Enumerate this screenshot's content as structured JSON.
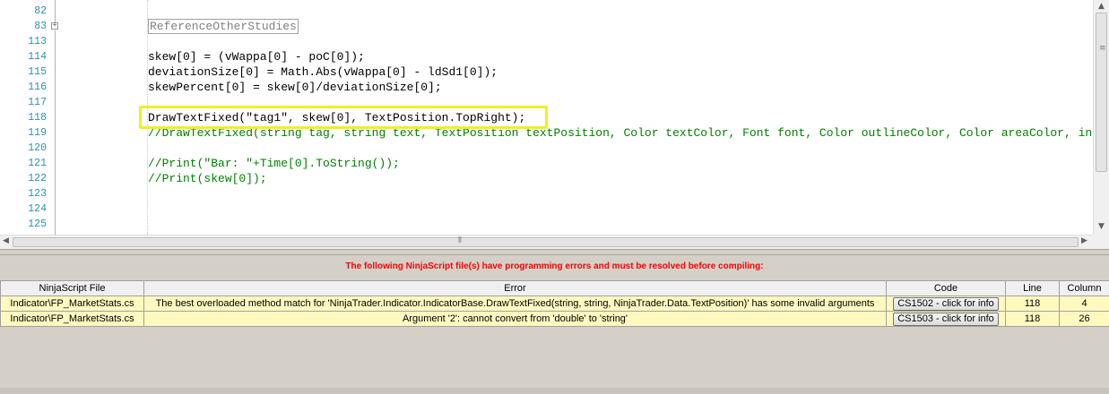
{
  "editor": {
    "lines": [
      {
        "num": "82",
        "code": "",
        "type": "blank"
      },
      {
        "num": "83",
        "code": "ReferenceOtherStudies",
        "type": "region",
        "fold": "+"
      },
      {
        "num": "113",
        "code": "",
        "type": "blank"
      },
      {
        "num": "114",
        "code": "skew[0] = (vWappa[0] - poC[0]);",
        "type": "code"
      },
      {
        "num": "115",
        "code": "deviationSize[0] = Math.Abs(vWappa[0] - ldSd1[0]);",
        "type": "code"
      },
      {
        "num": "116",
        "code": "skewPercent[0] = skew[0]/deviationSize[0];",
        "type": "code"
      },
      {
        "num": "117",
        "code": "",
        "type": "blank"
      },
      {
        "num": "118",
        "code": "DrawTextFixed(\"tag1\", skew[0], TextPosition.TopRight);",
        "type": "code"
      },
      {
        "num": "119",
        "code": "//DrawTextFixed(string tag, string text, TextPosition textPosition, Color textColor, Font font, Color outlineColor, Color areaColor, int opacity);",
        "type": "comment"
      },
      {
        "num": "120",
        "code": "",
        "type": "blank"
      },
      {
        "num": "121",
        "code": "//Print(\"Bar: \"+Time[0].ToString());",
        "type": "comment"
      },
      {
        "num": "122",
        "code": "//Print(skew[0]);",
        "type": "comment"
      },
      {
        "num": "123",
        "code": "",
        "type": "blank"
      },
      {
        "num": "124",
        "code": "",
        "type": "blank"
      },
      {
        "num": "125",
        "code": "",
        "type": "blank"
      }
    ]
  },
  "errors": {
    "message": "The following NinjaScript file(s) have programming errors and must be resolved before compiling:",
    "columns": [
      "NinjaScript File",
      "Error",
      "Code",
      "Line",
      "Column"
    ],
    "rows": [
      {
        "file": "Indicator\\FP_MarketStats.cs",
        "error": "The best overloaded method match for 'NinjaTrader.Indicator.IndicatorBase.DrawTextFixed(string, string, NinjaTrader.Data.TextPosition)' has some invalid arguments",
        "code": "CS1502 - click for info",
        "line": "118",
        "column": "4"
      },
      {
        "file": "Indicator\\FP_MarketStats.cs",
        "error": "Argument '2': cannot convert from 'double' to 'string'",
        "code": "CS1503 - click for info",
        "line": "118",
        "column": "26"
      }
    ]
  },
  "colors": {
    "line_number": "#2b91af",
    "comment": "#008000",
    "highlight_border": "#f0f020",
    "error_text": "#ff0000",
    "error_row_bg": "#fff9c0"
  },
  "icons": {
    "scroll_up": "up-arrow-icon",
    "scroll_down": "down-arrow-icon",
    "scroll_left": "left-arrow-icon",
    "scroll_right": "right-arrow-icon"
  }
}
